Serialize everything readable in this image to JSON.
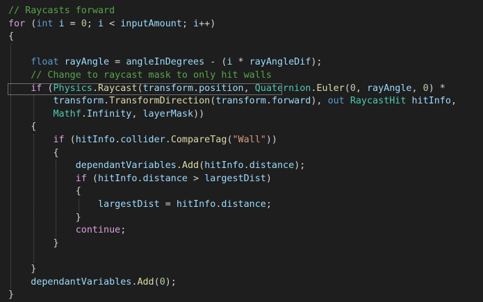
{
  "editor": {
    "language": "C#",
    "theme": {
      "background": "#1e1e1e",
      "comment": "#57a64a",
      "keyword": "#569cd6",
      "control": "#d8a0df",
      "variable": "#9cdcfe",
      "type": "#4ec9b0",
      "method": "#dcdcaa",
      "number": "#b5cea8",
      "string": "#d69d85",
      "plain": "#d4d4d4"
    },
    "current_line": 6,
    "lines": [
      [
        [
          "cmt",
          "// Raycasts forward"
        ]
      ],
      [
        [
          "ctl",
          "for"
        ],
        [
          "pl",
          " ("
        ],
        [
          "kw",
          "int"
        ],
        [
          "pl",
          " "
        ],
        [
          "var",
          "i"
        ],
        [
          "pl",
          " = "
        ],
        [
          "num",
          "0"
        ],
        [
          "pl",
          "; "
        ],
        [
          "var",
          "i"
        ],
        [
          "pl",
          " < "
        ],
        [
          "var",
          "inputAmount"
        ],
        [
          "pl",
          "; "
        ],
        [
          "var",
          "i"
        ],
        [
          "pl",
          "++)"
        ]
      ],
      [
        [
          "pl",
          "{"
        ]
      ],
      [
        [
          "pl",
          ""
        ]
      ],
      [
        [
          "pl",
          "    "
        ],
        [
          "kw",
          "float"
        ],
        [
          "pl",
          " "
        ],
        [
          "var",
          "rayAngle"
        ],
        [
          "pl",
          " = "
        ],
        [
          "var",
          "angleInDegrees"
        ],
        [
          "pl",
          " - ("
        ],
        [
          "var",
          "i"
        ],
        [
          "pl",
          " * "
        ],
        [
          "var",
          "rayAngleDif"
        ],
        [
          "pl",
          ");"
        ]
      ],
      [
        [
          "pl",
          "    "
        ],
        [
          "cmt",
          "// Change to raycast mask to only hit walls"
        ]
      ],
      [
        [
          "pl",
          "    "
        ],
        [
          "ctl",
          "if"
        ],
        [
          "pl",
          " ("
        ],
        [
          "typ",
          "Physics"
        ],
        [
          "pl",
          "."
        ],
        [
          "fn",
          "Raycast"
        ],
        [
          "pl",
          "("
        ],
        [
          "var",
          "transform"
        ],
        [
          "pl",
          "."
        ],
        [
          "var",
          "position"
        ],
        [
          "pl",
          ", "
        ],
        [
          "typ",
          "Quaternion"
        ],
        [
          "pl",
          "."
        ],
        [
          "fn",
          "Euler"
        ],
        [
          "pl",
          "("
        ],
        [
          "num",
          "0"
        ],
        [
          "pl",
          ", "
        ],
        [
          "var",
          "rayAngle"
        ],
        [
          "pl",
          ", "
        ],
        [
          "num",
          "0"
        ],
        [
          "pl",
          ") *"
        ]
      ],
      [
        [
          "pl",
          "        "
        ],
        [
          "var",
          "transform"
        ],
        [
          "pl",
          "."
        ],
        [
          "fn",
          "TransformDirection"
        ],
        [
          "pl",
          "("
        ],
        [
          "var",
          "transform"
        ],
        [
          "pl",
          "."
        ],
        [
          "var",
          "forward"
        ],
        [
          "pl",
          "), "
        ],
        [
          "kw",
          "out"
        ],
        [
          "pl",
          " "
        ],
        [
          "typ",
          "RaycastHit"
        ],
        [
          "pl",
          " "
        ],
        [
          "var",
          "hitInfo"
        ],
        [
          "pl",
          ","
        ]
      ],
      [
        [
          "pl",
          "        "
        ],
        [
          "typ",
          "Mathf"
        ],
        [
          "pl",
          "."
        ],
        [
          "var",
          "Infinity"
        ],
        [
          "pl",
          ", "
        ],
        [
          "var",
          "layerMask"
        ],
        [
          "pl",
          "))"
        ]
      ],
      [
        [
          "pl",
          "    {"
        ]
      ],
      [
        [
          "pl",
          "        "
        ],
        [
          "ctl",
          "if"
        ],
        [
          "pl",
          " ("
        ],
        [
          "var",
          "hitInfo"
        ],
        [
          "pl",
          "."
        ],
        [
          "var",
          "collider"
        ],
        [
          "pl",
          "."
        ],
        [
          "fn",
          "CompareTag"
        ],
        [
          "pl",
          "("
        ],
        [
          "str",
          "\"Wall\""
        ],
        [
          "pl",
          "))"
        ]
      ],
      [
        [
          "pl",
          "        {"
        ]
      ],
      [
        [
          "pl",
          "            "
        ],
        [
          "var",
          "dependantVariables"
        ],
        [
          "pl",
          "."
        ],
        [
          "fn",
          "Add"
        ],
        [
          "pl",
          "("
        ],
        [
          "var",
          "hitInfo"
        ],
        [
          "pl",
          "."
        ],
        [
          "var",
          "distance"
        ],
        [
          "pl",
          ");"
        ]
      ],
      [
        [
          "pl",
          "            "
        ],
        [
          "ctl",
          "if"
        ],
        [
          "pl",
          " ("
        ],
        [
          "var",
          "hitInfo"
        ],
        [
          "pl",
          "."
        ],
        [
          "var",
          "distance"
        ],
        [
          "pl",
          " > "
        ],
        [
          "var",
          "largestDist"
        ],
        [
          "pl",
          ")"
        ]
      ],
      [
        [
          "pl",
          "            {"
        ]
      ],
      [
        [
          "pl",
          "                "
        ],
        [
          "var",
          "largestDist"
        ],
        [
          "pl",
          " = "
        ],
        [
          "var",
          "hitInfo"
        ],
        [
          "pl",
          "."
        ],
        [
          "var",
          "distance"
        ],
        [
          "pl",
          ";"
        ]
      ],
      [
        [
          "pl",
          "            }"
        ]
      ],
      [
        [
          "pl",
          "            "
        ],
        [
          "ctl",
          "continue"
        ],
        [
          "pl",
          ";"
        ]
      ],
      [
        [
          "pl",
          "        }"
        ]
      ],
      [
        [
          "pl",
          ""
        ]
      ],
      [
        [
          "pl",
          "    }"
        ]
      ],
      [
        [
          "pl",
          "    "
        ],
        [
          "var",
          "dependantVariables"
        ],
        [
          "pl",
          "."
        ],
        [
          "fn",
          "Add"
        ],
        [
          "pl",
          "("
        ],
        [
          "num",
          "0"
        ],
        [
          "pl",
          ");"
        ]
      ],
      [
        [
          "pl",
          "}"
        ]
      ]
    ]
  }
}
